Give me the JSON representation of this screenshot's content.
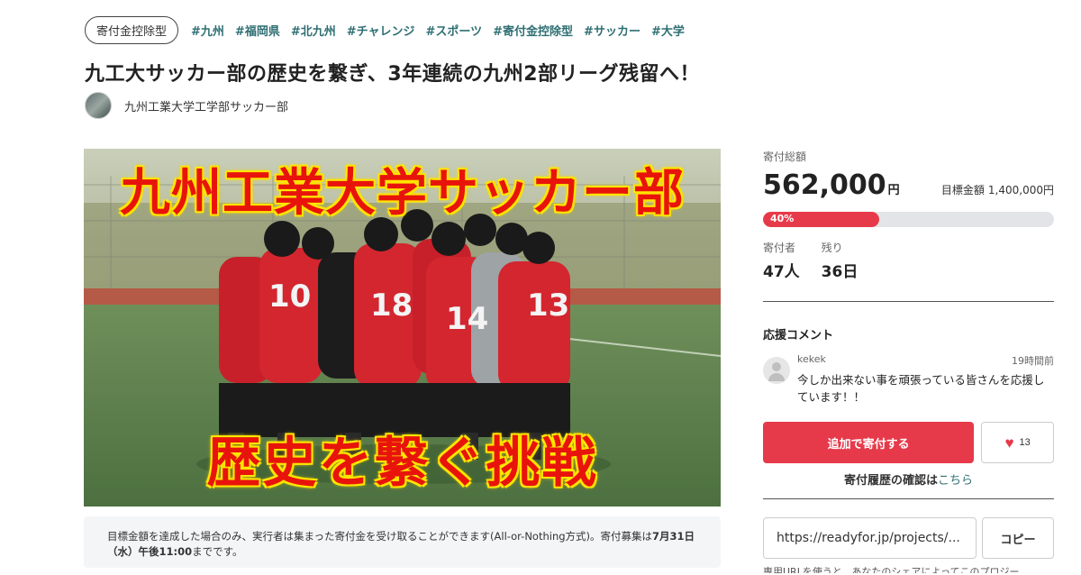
{
  "header": {
    "type_badge": "寄付金控除型",
    "tags": [
      "#九州",
      "#福岡県",
      "#北九州",
      "#チャレンジ",
      "#スポーツ",
      "#寄付金控除型",
      "#サッカー",
      "#大学"
    ]
  },
  "project": {
    "title": "九工大サッカー部の歴史を繋ぎ、3年連続の九州2部リーグ残留へ！",
    "owner": "九州工業大学工学部サッカー部"
  },
  "hero": {
    "top_text": "九州工業大学サッカー部",
    "bottom_text": "歴史を繋ぐ挑戦",
    "jersey_numbers": [
      "10",
      "18",
      "14",
      "13"
    ]
  },
  "notice": {
    "text_1": "目標金額を達成した場合のみ、実行者は集まった寄付金を受け取ることができます(All-or-Nothing方式)。寄付募集は",
    "date_bold": "7月31日（水）午後11:00",
    "text_2": "までです。"
  },
  "stats": {
    "total_label": "寄付総額",
    "total_amount": "562,000",
    "total_unit": "円",
    "goal_label": "目標金額",
    "goal_amount": "1,400,000円",
    "progress_percent": 40,
    "progress_label": "40%",
    "donors_label": "寄付者",
    "donors_value": "47人",
    "remaining_label": "残り",
    "remaining_value": "36日"
  },
  "comments": {
    "title": "応援コメント",
    "items": [
      {
        "user": "kekek",
        "time": "19時間前",
        "text": "今しか出来ない事を頑張っている皆さんを応援しています！！"
      }
    ]
  },
  "actions": {
    "donate_label": "追加で寄付する",
    "like_count": "13",
    "history_bold": "寄付履歴の確認は",
    "history_link": "こちら"
  },
  "share": {
    "url": "https://readyfor.jp/projects/...",
    "copy_label": "コピー",
    "note": "専用URLを使うと、あなたのシェアによってこのプロジー"
  },
  "colors": {
    "accent": "#e63a4b",
    "tag": "#2f6f73",
    "hero_text": "#e8140c",
    "hero_outline": "#ffe800"
  }
}
